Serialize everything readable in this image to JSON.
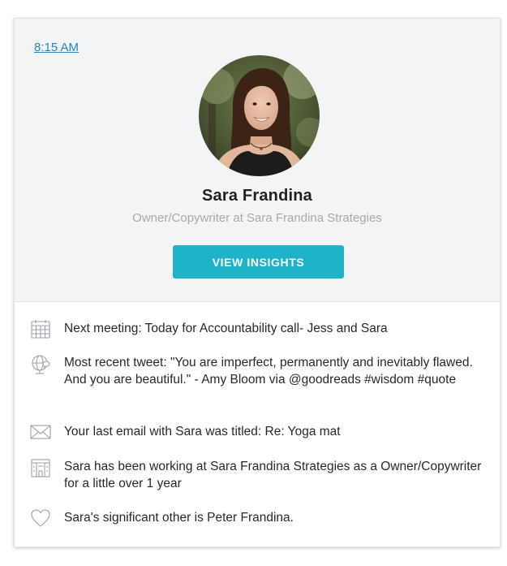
{
  "card": {
    "time_link": "8:15 AM",
    "profile": {
      "name": "Sara Frandina",
      "title": "Owner/Copywriter at Sara Frandina Strategies",
      "avatar": "profile-photo"
    },
    "insights_button": "VIEW INSIGHTS"
  },
  "facts": [
    {
      "icon": "calendar-icon",
      "text": "Next meeting: Today for Accountability call- Jess and Sara"
    },
    {
      "icon": "globe-chat-icon",
      "text": "Most recent tweet: \"You are imperfect, permanently and inevitably flawed. And you are beautiful.\" - Amy Bloom via @goodreads #wisdom #quote"
    },
    {
      "icon": "envelope-icon",
      "text": "Your last email with Sara was titled: Re: Yoga mat"
    },
    {
      "icon": "building-icon",
      "text": "Sara has been working at Sara Frandina Strategies as a Owner/Copywriter for a little over 1 year"
    },
    {
      "icon": "heart-icon",
      "text": "Sara's significant other is Peter Frandina."
    }
  ],
  "colors": {
    "accent": "#1fb3c8",
    "link": "#1f87c9",
    "header_bg": "#f3f4f6",
    "subtitle": "#a3aab2",
    "icon": "#9aa1a8"
  }
}
